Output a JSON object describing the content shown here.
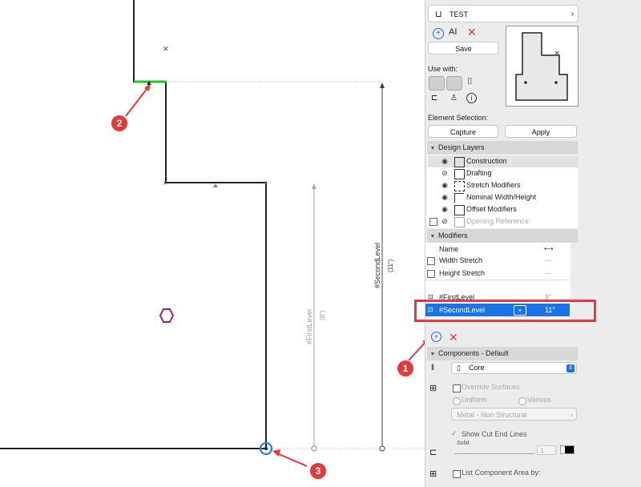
{
  "panel": {
    "element_name": "TEST",
    "save_label": "Save",
    "use_with_label": "Use with:",
    "element_selection_label": "Element Selection:",
    "capture_label": "Capture",
    "apply_label": "Apply",
    "design_layers_header": "Design Layers",
    "layers": [
      {
        "name": "Construction",
        "icon": "construction-icon"
      },
      {
        "name": "Drafting",
        "icon": "drafting-icon"
      },
      {
        "name": "Stretch Modifiers",
        "icon": "stretch-modifiers-icon"
      },
      {
        "name": "Nominal Width/Height",
        "icon": "nominal-width-icon"
      },
      {
        "name": "Offset Modifiers",
        "icon": "offset-modifiers-icon"
      },
      {
        "name": "Opening Reference",
        "icon": "opening-reference-icon"
      }
    ],
    "modifiers_header": "Modifiers",
    "modifiers_col_name": "Name",
    "modifiers": [
      {
        "name": "Width Stretch",
        "value": "---"
      },
      {
        "name": "Height Stretch",
        "value": "---"
      },
      {
        "name": "#FirstLevel",
        "value": "8\""
      },
      {
        "name": "#SecondLevel",
        "value": "11\""
      }
    ],
    "components_header": "Components - Default",
    "component_value": "Core",
    "override_surfaces_label": "Override Surfaces",
    "uniform_label": "Uniform",
    "various_label": "Various",
    "surface_value": "Metal - Non Structural",
    "show_cut_end_lines_label": "Show Cut End Lines",
    "line_type_value": "Solid",
    "pen_value": "1",
    "list_component_area_label": "List Component Area by:"
  },
  "canvas": {
    "dim_first_level": "#FirstLevel",
    "dim_first_level_value": "(8\")",
    "dim_second_level": "#SecondLevel",
    "dim_second_level_value": "(11\")"
  },
  "callouts": [
    "1",
    "2",
    "3"
  ],
  "colors": {
    "accent": "#1a73e8",
    "callout": "#e23b3b",
    "highlight": "#e8383d",
    "green": "#21c521"
  }
}
